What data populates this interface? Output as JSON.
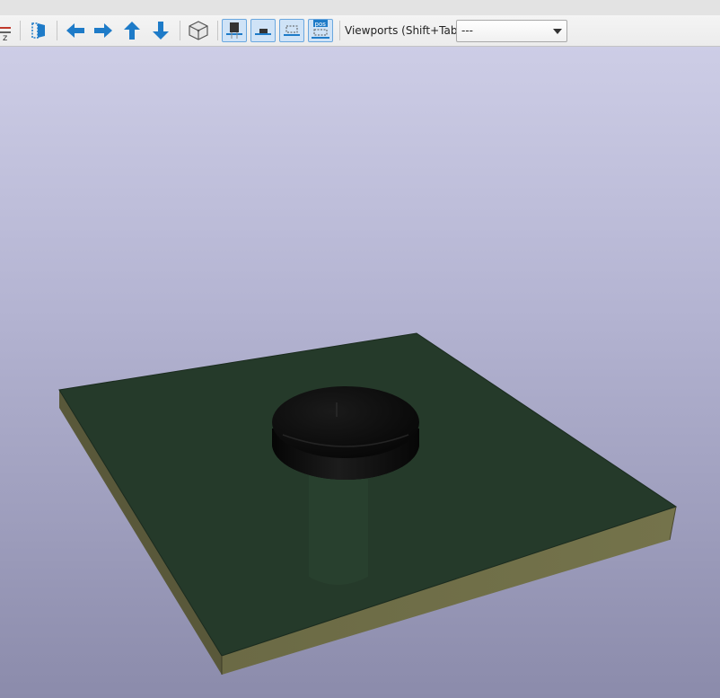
{
  "toolbar": {
    "icons": [
      {
        "name": "flip-icon"
      },
      {
        "name": "render-view-icon"
      },
      {
        "name": "arrow-left-icon"
      },
      {
        "name": "arrow-right-icon"
      },
      {
        "name": "arrow-up-icon"
      },
      {
        "name": "arrow-down-icon"
      },
      {
        "name": "box-3d-icon"
      },
      {
        "name": "tht-components-icon",
        "checked": true
      },
      {
        "name": "smd-components-icon",
        "checked": true
      },
      {
        "name": "virtual-components-icon",
        "checked": true
      },
      {
        "name": "not-in-pos-icon",
        "checked": true
      }
    ],
    "axis_glyph": "z",
    "pos_badge": "pos",
    "viewports_label": "Viewports (Shift+Tab):",
    "viewports_value": "---"
  },
  "colors": {
    "accent": "#1e7bc8",
    "board_top": "#253a2a",
    "board_edge": "#6a6942",
    "background_top": "#cdcde6",
    "background_bottom": "#8b8bab"
  },
  "scene": {
    "objects": [
      "pcb-board",
      "round-cap-component"
    ]
  }
}
